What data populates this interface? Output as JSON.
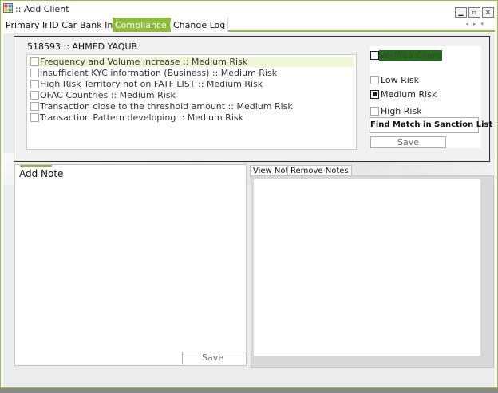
{
  "window": {
    "title": ":: Add Client",
    "icon": "app-window-icon",
    "controls": {
      "minimize": "▁",
      "restore": "▫",
      "close": "✕"
    }
  },
  "tabs": {
    "items": [
      {
        "label": "Primary Info"
      },
      {
        "label": "ID Card"
      },
      {
        "label": "Bank Info"
      },
      {
        "label": "Compliance Risk"
      },
      {
        "label": "Change Log"
      }
    ],
    "active_index": 3,
    "scroll": {
      "left": "◂",
      "right": "▸",
      "menu": "▾"
    }
  },
  "compliance": {
    "client_label": "518593 :: AHMED YAQUB",
    "risk_items": [
      {
        "label": "Frequency and Volume Increase :: Medium Risk",
        "checked": false,
        "selected": true
      },
      {
        "label": "Insufficient KYC information (Business) :: Medium Risk",
        "checked": false,
        "selected": false
      },
      {
        "label": "High Risk Territory not on FATF LIST :: Medium Risk",
        "checked": false,
        "selected": false
      },
      {
        "label": "OFAC Countries :: Medium Risk",
        "checked": false,
        "selected": false
      },
      {
        "label": "Transaction close to the threshold amount  :: Medium Risk",
        "checked": false,
        "selected": false
      },
      {
        "label": "Transaction Pattern developing  :: Medium Risk",
        "checked": false,
        "selected": false
      }
    ],
    "verified_client": {
      "label": "Verified Client",
      "checked": false
    },
    "risk_levels": [
      {
        "label": "Low Risk",
        "checked": false
      },
      {
        "label": "Medium Risk",
        "checked": true
      },
      {
        "label": "High Risk",
        "checked": false
      }
    ],
    "find_match_button": "Find Match in Sanction List",
    "save_button": "Save"
  },
  "notes": {
    "add_note_label": "Add Note",
    "save_button": "Save",
    "tabs": [
      {
        "label": "View Notes"
      },
      {
        "label": "Remove Notes"
      }
    ],
    "active_tab_index": 0
  },
  "colors": {
    "accent": "#8cbd3a",
    "verified_highlight": "#1e6e18",
    "frame_border": "#2b2b2b"
  }
}
